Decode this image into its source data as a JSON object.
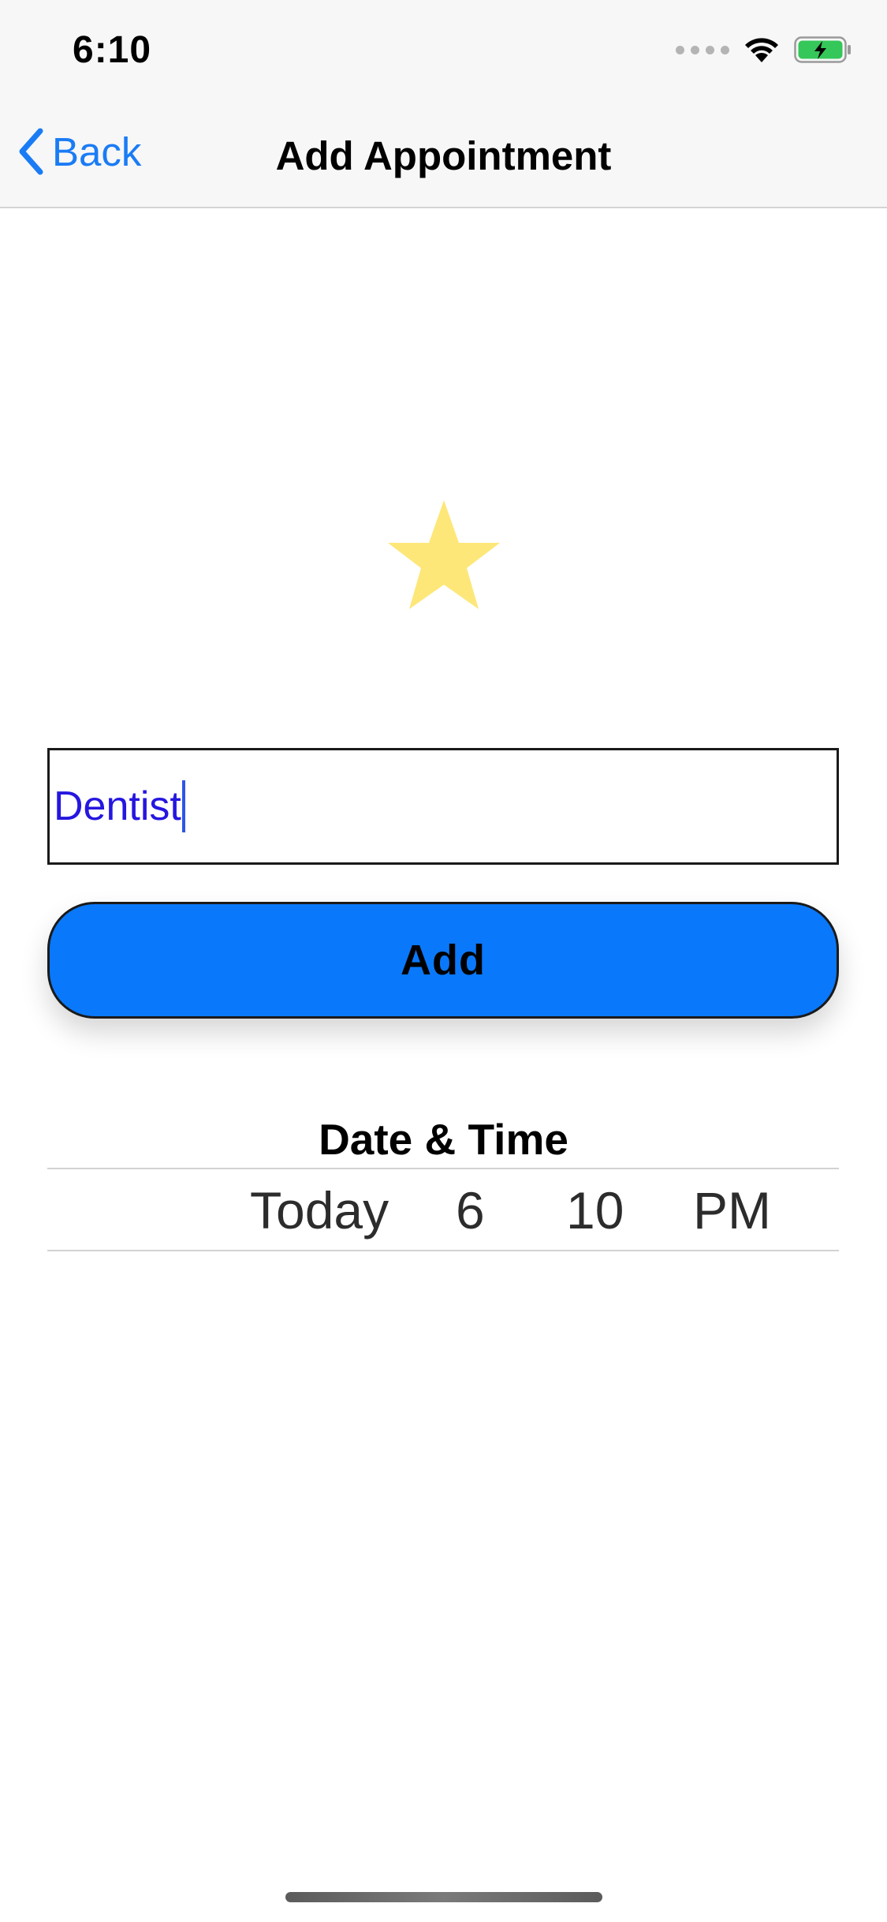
{
  "status_bar": {
    "time": "6:10",
    "icons": [
      "cellular-signal-icon",
      "wifi-icon",
      "battery-charging-icon"
    ],
    "battery_color": "#35c759"
  },
  "nav_bar": {
    "back_label": "Back",
    "title": "Add Appointment",
    "tint_color": "#1a7cf5"
  },
  "content": {
    "icon": "star-icon",
    "star_color": "#fde779",
    "name_field": {
      "value": "Dentist",
      "text_color": "#2516e0"
    },
    "add_button": {
      "label": "Add",
      "background_color": "#0a78fa"
    },
    "date_picker": {
      "label": "Date & Time",
      "day": "Today",
      "hour": "6",
      "minute": "10",
      "period": "PM"
    }
  }
}
